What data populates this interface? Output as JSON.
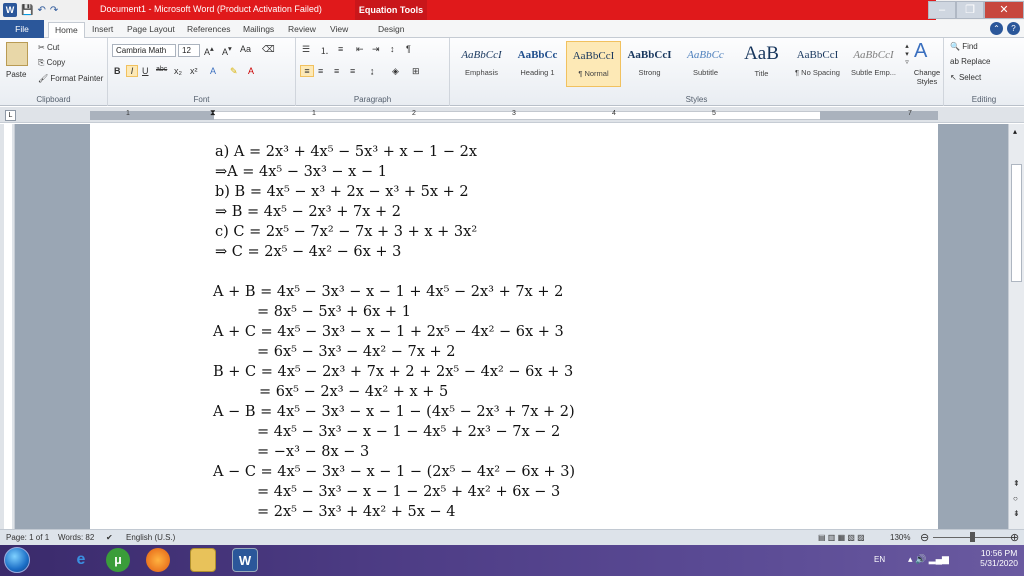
{
  "titlebar": {
    "title": "Document1 - Microsoft Word (Product Activation Failed)",
    "context_tab": "Equation Tools",
    "minimize": "–",
    "restore": "❐",
    "close": "✕"
  },
  "tabs": {
    "file": "File",
    "home": "Home",
    "insert": "Insert",
    "page_layout": "Page Layout",
    "references": "References",
    "mailings": "Mailings",
    "review": "Review",
    "view": "View",
    "design": "Design"
  },
  "ribbon": {
    "clipboard": {
      "label": "Clipboard",
      "paste": "Paste",
      "cut": "Cut",
      "copy": "Copy",
      "format_painter": "Format Painter"
    },
    "font": {
      "label": "Font",
      "font_name": "Cambria Math",
      "font_size": "12"
    },
    "paragraph": {
      "label": "Paragraph"
    },
    "styles": {
      "label": "Styles",
      "items": [
        {
          "sample": "AaBbCcI",
          "name": "Emphasis"
        },
        {
          "sample": "AaBbCc",
          "name": "Heading 1"
        },
        {
          "sample": "AaBbCcI",
          "name": "¶ Normal"
        },
        {
          "sample": "AaBbCcI",
          "name": "Strong"
        },
        {
          "sample": "AaBbCc",
          "name": "Subtitle"
        },
        {
          "sample": "AaB",
          "name": "Title"
        },
        {
          "sample": "AaBbCcI",
          "name": "¶ No Spacing"
        },
        {
          "sample": "AaBbCcI",
          "name": "Subtle Emp..."
        }
      ],
      "change_styles": "Change Styles"
    },
    "editing": {
      "label": "Editing",
      "find": "Find",
      "replace": "Replace",
      "select": "Select"
    }
  },
  "ruler": {
    "corner": "L",
    "numbers": [
      "1",
      "1",
      "2",
      "3",
      "4",
      "5",
      "7"
    ]
  },
  "document": {
    "lines": [
      "a) A = 2x³ + 4x⁵ − 5x³ + x − 1 − 2x",
      "⇒A = 4x⁵ − 3x³ − x − 1",
      "b) B = 4x⁵ − x³ + 2x − x³ + 5x + 2",
      "⇒ B = 4x⁵ − 2x³ + 7x + 2",
      "c) C = 2x⁵ − 7x² − 7x + 3 + x + 3x²",
      "⇒ C = 2x⁵ − 4x² − 6x + 3",
      "A + B = 4x⁵ − 3x³ − x − 1 + 4x⁵ − 2x³ + 7x + 2",
      "= 8x⁵ − 5x³ + 6x + 1",
      "A + C = 4x⁵ − 3x³ − x − 1 + 2x⁵ − 4x² − 6x + 3",
      "= 6x⁵ − 3x³ − 4x² − 7x + 2",
      "B + C = 4x⁵ − 2x³ + 7x + 2 + 2x⁵ − 4x² − 6x + 3",
      "= 6x⁵ − 2x³ − 4x² + x + 5",
      "A − B = 4x⁵ − 3x³ − x − 1 − (4x⁵ − 2x³ + 7x + 2)",
      "= 4x⁵ − 3x³ − x − 1 − 4x⁵ + 2x³ − 7x − 2",
      "= −x³ − 8x − 3",
      "A − C = 4x⁵ − 3x³ − x − 1 − (2x⁵ − 4x² − 6x + 3)",
      "= 4x⁵ − 3x³ − x − 1 − 2x⁵ + 4x² + 6x − 3",
      "= 2x⁵ − 3x³ + 4x² + 5x − 4"
    ]
  },
  "status": {
    "page": "Page: 1 of 1",
    "words": "Words: 82",
    "language": "English (U.S.)",
    "zoom": "130%"
  },
  "taskbar": {
    "lang": "EN",
    "time": "10:56 PM",
    "date": "5/31/2020"
  }
}
